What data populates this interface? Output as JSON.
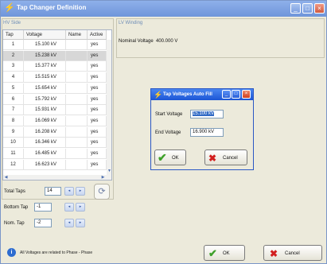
{
  "window": {
    "title": "Tap Changer Definition",
    "controls": {
      "minimize": "_",
      "maximize": "□",
      "close": "×"
    }
  },
  "hv_side": {
    "label": "HV Side",
    "columns": [
      "Tap",
      "Voltage",
      "Name",
      "Active"
    ],
    "rows": [
      {
        "tap": "1",
        "voltage": "15.100 kV",
        "name": "",
        "active": "yes"
      },
      {
        "tap": "2",
        "voltage": "15.238 kV",
        "name": "",
        "active": "yes"
      },
      {
        "tap": "3",
        "voltage": "15.377 kV",
        "name": "",
        "active": "yes"
      },
      {
        "tap": "4",
        "voltage": "15.515 kV",
        "name": "",
        "active": "yes"
      },
      {
        "tap": "5",
        "voltage": "15.654 kV",
        "name": "",
        "active": "yes"
      },
      {
        "tap": "6",
        "voltage": "15.792 kV",
        "name": "",
        "active": "yes"
      },
      {
        "tap": "7",
        "voltage": "15.931 kV",
        "name": "",
        "active": "yes"
      },
      {
        "tap": "8",
        "voltage": "16.069 kV",
        "name": "",
        "active": "yes"
      },
      {
        "tap": "9",
        "voltage": "16.208 kV",
        "name": "",
        "active": "yes"
      },
      {
        "tap": "10",
        "voltage": "16.346 kV",
        "name": "",
        "active": "yes"
      },
      {
        "tap": "11",
        "voltage": "16.485 kV",
        "name": "",
        "active": "yes"
      },
      {
        "tap": "12",
        "voltage": "16.623 kV",
        "name": "",
        "active": "yes"
      }
    ],
    "selected_row": 2
  },
  "lv_winding": {
    "label": "LV Winding",
    "nominal_voltage_label": "Nominal Voltage",
    "nominal_voltage_value": "400.000 V"
  },
  "tap_settings": {
    "total_taps_label": "Total Taps",
    "total_taps_value": "14",
    "bottom_tap_label": "Bottom Tap",
    "bottom_tap_value": "-1",
    "nom_tap_label": "Nom. Tap",
    "nom_tap_value": "-2"
  },
  "spin_glyphs": {
    "down": "◂",
    "up": "▸"
  },
  "dialog": {
    "title": "Tap Voltages Auto Fill",
    "start_voltage_label": "Start Voltage",
    "start_voltage_value": "15.100 kV",
    "end_voltage_label": "End Voltage",
    "end_voltage_value": "16.900 kV",
    "ok_label": "OK",
    "cancel_label": "Cancel"
  },
  "status_bar": {
    "info_text": "All Voltages are related to Phase - Phase",
    "ok_label": "OK",
    "cancel_label": "Cancel"
  },
  "icons": {
    "check": "✔",
    "cross": "✖",
    "info": "i",
    "recalc": "⟳",
    "title": "⚡"
  },
  "colors": {
    "title_bar": "#6f95da",
    "dialog_title_bar": "#1b55d5",
    "selection_highlight": "#316ac5",
    "ok_check": "#3ea02a",
    "cancel_cross": "#d21f1f"
  }
}
